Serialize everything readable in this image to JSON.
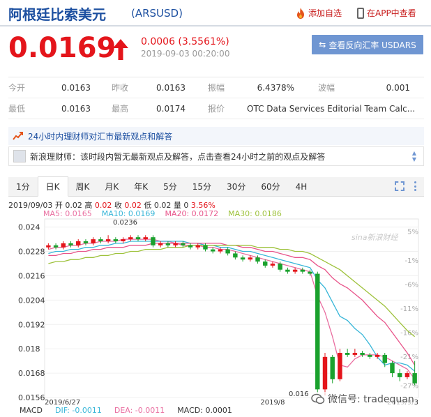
{
  "header": {
    "title": "阿根廷比索美元",
    "code": "(ARSUSD)",
    "fav_label": "添加自选",
    "app_label": "在APP中查看"
  },
  "quote": {
    "price": "0.0169",
    "change": "0.0006 (3.5561%)",
    "time": "2019-09-03 00:20:00",
    "reverse_label": "查看反向汇率 USDARS",
    "up_color": "#e4151b"
  },
  "stats": {
    "rows": [
      [
        {
          "label": "今开",
          "value": "0.0163"
        },
        {
          "label": "昨收",
          "value": "0.0163"
        },
        {
          "label": "振幅",
          "value": "6.4378%"
        },
        {
          "label": "波幅",
          "value": "0.001"
        }
      ],
      [
        {
          "label": "最低",
          "value": "0.0163"
        },
        {
          "label": "最高",
          "value": "0.0174"
        },
        {
          "label": "报价",
          "value": "OTC Data Services Editorial Team Calc..."
        },
        {
          "label": "",
          "value": ""
        }
      ]
    ]
  },
  "opinion": {
    "headline": "24小时内理财师对汇市最新观点和解答",
    "message": "新浪理财师：该时段内暂无最新观点及解答，点击查看24小时之前的观点及解答"
  },
  "tabs": [
    {
      "label": "1分",
      "active": false
    },
    {
      "label": "日K",
      "active": true
    },
    {
      "label": "周K",
      "active": false
    },
    {
      "label": "月K",
      "active": false
    },
    {
      "label": "年K",
      "active": false
    },
    {
      "label": "5分",
      "active": false
    },
    {
      "label": "15分",
      "active": false
    },
    {
      "label": "30分",
      "active": false
    },
    {
      "label": "60分",
      "active": false
    },
    {
      "label": "4H",
      "active": false
    }
  ],
  "chart_info": {
    "date": "2019/09/03",
    "open_label": "开",
    "open": "0.02",
    "high_label": "高",
    "high": "0.02",
    "close_label": "收",
    "close": "0.02",
    "low_label": "低",
    "low": "0.02",
    "vol_label": "量",
    "vol": "0",
    "pct": "3.56%"
  },
  "ma_legend": [
    {
      "label": "MA5: 0.0165",
      "color": "#e96ea0"
    },
    {
      "label": "MA10: 0.0169",
      "color": "#38b6d8"
    },
    {
      "label": "MA20: 0.0172",
      "color": "#e8548a"
    },
    {
      "label": "MA30: 0.0186",
      "color": "#9ec23c"
    }
  ],
  "chart_data": {
    "type": "candlestick",
    "y_ticks": [
      "0.024",
      "0.0228",
      "0.0216",
      "0.0204",
      "0.0192",
      "0.018",
      "0.0168",
      "0.0156"
    ],
    "y_tick_values": [
      0.024,
      0.0228,
      0.0216,
      0.0204,
      0.0192,
      0.018,
      0.0168,
      0.0156
    ],
    "y_range": [
      0.0156,
      0.0244
    ],
    "right_ticks": [
      "5%",
      "-1%",
      "-6%",
      "-11%",
      "-16%",
      "-21%",
      "-27%"
    ],
    "right_tick_values": [
      5,
      -1,
      -6,
      -11,
      -16,
      -21,
      -27
    ],
    "right_range": [
      -29.5,
      7.5
    ],
    "x_labels": [
      "2019/6/27",
      "2019/8",
      "2019/9/3"
    ],
    "x_label_index": [
      0,
      30,
      49
    ],
    "high_annotation": "0.0236",
    "low_annotation": "0.016",
    "candles": [
      [
        0.023,
        0.0231,
        0.0232,
        0.0229
      ],
      [
        0.0231,
        0.023,
        0.0232,
        0.0229
      ],
      [
        0.023,
        0.0232,
        0.0233,
        0.0229
      ],
      [
        0.0232,
        0.0231,
        0.0233,
        0.023
      ],
      [
        0.0231,
        0.0233,
        0.0234,
        0.023
      ],
      [
        0.0233,
        0.0232,
        0.0234,
        0.0231
      ],
      [
        0.0232,
        0.0234,
        0.0235,
        0.0231
      ],
      [
        0.0234,
        0.0233,
        0.0235,
        0.0232
      ],
      [
        0.0233,
        0.0234,
        0.0236,
        0.0232
      ],
      [
        0.0234,
        0.0233,
        0.0235,
        0.0232
      ],
      [
        0.0233,
        0.0234,
        0.0235,
        0.0232
      ],
      [
        0.0234,
        0.0235,
        0.0236,
        0.0233
      ],
      [
        0.0235,
        0.0234,
        0.0236,
        0.0233
      ],
      [
        0.0234,
        0.0235,
        0.0236,
        0.0233
      ],
      [
        0.0235,
        0.0231,
        0.0236,
        0.023
      ],
      [
        0.0231,
        0.0232,
        0.0233,
        0.023
      ],
      [
        0.0232,
        0.0231,
        0.0233,
        0.023
      ],
      [
        0.0231,
        0.0232,
        0.0233,
        0.023
      ],
      [
        0.0232,
        0.0231,
        0.0233,
        0.023
      ],
      [
        0.0231,
        0.023,
        0.0232,
        0.0229
      ],
      [
        0.023,
        0.0231,
        0.0232,
        0.0229
      ],
      [
        0.0231,
        0.0229,
        0.0232,
        0.0228
      ],
      [
        0.0229,
        0.0228,
        0.023,
        0.0227
      ],
      [
        0.0228,
        0.0229,
        0.023,
        0.0227
      ],
      [
        0.0229,
        0.0227,
        0.023,
        0.0226
      ],
      [
        0.0227,
        0.0225,
        0.0228,
        0.0224
      ],
      [
        0.0225,
        0.0224,
        0.0226,
        0.0223
      ],
      [
        0.0224,
        0.0225,
        0.0226,
        0.0223
      ],
      [
        0.0225,
        0.0223,
        0.0226,
        0.0222
      ],
      [
        0.0223,
        0.0221,
        0.0224,
        0.022
      ],
      [
        0.0221,
        0.0222,
        0.0223,
        0.022
      ],
      [
        0.0222,
        0.0219,
        0.0223,
        0.0218
      ],
      [
        0.0219,
        0.0218,
        0.022,
        0.0217
      ],
      [
        0.0218,
        0.0219,
        0.022,
        0.0217
      ],
      [
        0.0219,
        0.0218,
        0.022,
        0.0217
      ],
      [
        0.0218,
        0.0217,
        0.0219,
        0.0216
      ],
      [
        0.0217,
        0.016,
        0.0218,
        0.0158
      ],
      [
        0.016,
        0.0176,
        0.0178,
        0.0157
      ],
      [
        0.0176,
        0.0165,
        0.0177,
        0.0163
      ],
      [
        0.0165,
        0.0178,
        0.018,
        0.0164
      ],
      [
        0.0178,
        0.0177,
        0.018,
        0.0176
      ],
      [
        0.0177,
        0.0178,
        0.018,
        0.0176
      ],
      [
        0.0178,
        0.0177,
        0.0179,
        0.0176
      ],
      [
        0.0177,
        0.0176,
        0.0178,
        0.0175
      ],
      [
        0.0176,
        0.0177,
        0.0178,
        0.0175
      ],
      [
        0.0177,
        0.0173,
        0.0178,
        0.0171
      ],
      [
        0.0173,
        0.0168,
        0.0174,
        0.0166
      ],
      [
        0.0168,
        0.0166,
        0.017,
        0.0164
      ],
      [
        0.0166,
        0.0168,
        0.0169,
        0.0165
      ],
      [
        0.0168,
        0.0163,
        0.0174,
        0.0162
      ]
    ],
    "ma_series": [
      {
        "name": "MA5",
        "color": "#e96ea0",
        "values": [
          0.0229,
          0.023,
          0.023,
          0.0231,
          0.0231,
          0.0232,
          0.0232,
          0.0233,
          0.0233,
          0.0233,
          0.0234,
          0.0234,
          0.0234,
          0.0234,
          0.0234,
          0.0233,
          0.0233,
          0.0232,
          0.0231,
          0.0231,
          0.0231,
          0.023,
          0.023,
          0.0229,
          0.0229,
          0.0228,
          0.0227,
          0.0226,
          0.0225,
          0.0224,
          0.0223,
          0.0222,
          0.0221,
          0.022,
          0.0219,
          0.0218,
          0.0206,
          0.0198,
          0.0186,
          0.0172,
          0.0171,
          0.0175,
          0.0177,
          0.0177,
          0.0177,
          0.0176,
          0.0174,
          0.0172,
          0.017,
          0.0165
        ]
      },
      {
        "name": "MA10",
        "color": "#38b6d8",
        "values": [
          0.0227,
          0.0228,
          0.0228,
          0.0229,
          0.0229,
          0.023,
          0.023,
          0.0231,
          0.0231,
          0.0232,
          0.0232,
          0.0233,
          0.0233,
          0.0233,
          0.0233,
          0.0233,
          0.0233,
          0.0233,
          0.0233,
          0.0232,
          0.0232,
          0.0231,
          0.0231,
          0.023,
          0.023,
          0.0229,
          0.0228,
          0.0228,
          0.0227,
          0.0226,
          0.0225,
          0.0224,
          0.0223,
          0.0222,
          0.0221,
          0.022,
          0.0214,
          0.021,
          0.0203,
          0.0196,
          0.0194,
          0.019,
          0.0187,
          0.0182,
          0.0176,
          0.0172,
          0.0173,
          0.0173,
          0.0172,
          0.0169
        ]
      },
      {
        "name": "MA20",
        "color": "#e8548a",
        "values": [
          0.0226,
          0.0226,
          0.0227,
          0.0227,
          0.0228,
          0.0228,
          0.0229,
          0.0229,
          0.023,
          0.023,
          0.023,
          0.0231,
          0.0231,
          0.0231,
          0.0232,
          0.0232,
          0.0232,
          0.0232,
          0.0232,
          0.0232,
          0.0232,
          0.0232,
          0.0232,
          0.0232,
          0.0231,
          0.0231,
          0.023,
          0.023,
          0.0229,
          0.0228,
          0.0228,
          0.0227,
          0.0226,
          0.0225,
          0.0225,
          0.0224,
          0.0221,
          0.0219,
          0.0215,
          0.0212,
          0.021,
          0.0207,
          0.0204,
          0.02,
          0.0196,
          0.0193,
          0.0188,
          0.0183,
          0.0178,
          0.0172
        ]
      },
      {
        "name": "MA30",
        "color": "#9ec23c",
        "values": [
          0.0222,
          0.0223,
          0.0223,
          0.0224,
          0.0224,
          0.0225,
          0.0225,
          0.0226,
          0.0226,
          0.0227,
          0.0227,
          0.0228,
          0.0228,
          0.0229,
          0.0229,
          0.0229,
          0.023,
          0.023,
          0.023,
          0.0231,
          0.0231,
          0.0231,
          0.0231,
          0.0231,
          0.0231,
          0.0231,
          0.0231,
          0.0231,
          0.023,
          0.023,
          0.023,
          0.0229,
          0.0229,
          0.0228,
          0.0228,
          0.0227,
          0.0225,
          0.0223,
          0.0221,
          0.0219,
          0.0216,
          0.0213,
          0.021,
          0.0207,
          0.0204,
          0.0201,
          0.0197,
          0.0193,
          0.0189,
          0.0186
        ]
      }
    ],
    "up_color": "#e4151b",
    "down_color": "#1aa12d"
  },
  "watermark": {
    "brand": "sina新浪财经",
    "wechat": "微信号: tradequan"
  },
  "macd": [
    {
      "label": "MACD",
      "color": "#333333"
    },
    {
      "label": "DIF: -0.0011",
      "color": "#38b6d8"
    },
    {
      "label": "DEA: -0.0011",
      "color": "#e96ea0"
    },
    {
      "label": "MACD: 0.0001",
      "color": "#333333"
    }
  ]
}
